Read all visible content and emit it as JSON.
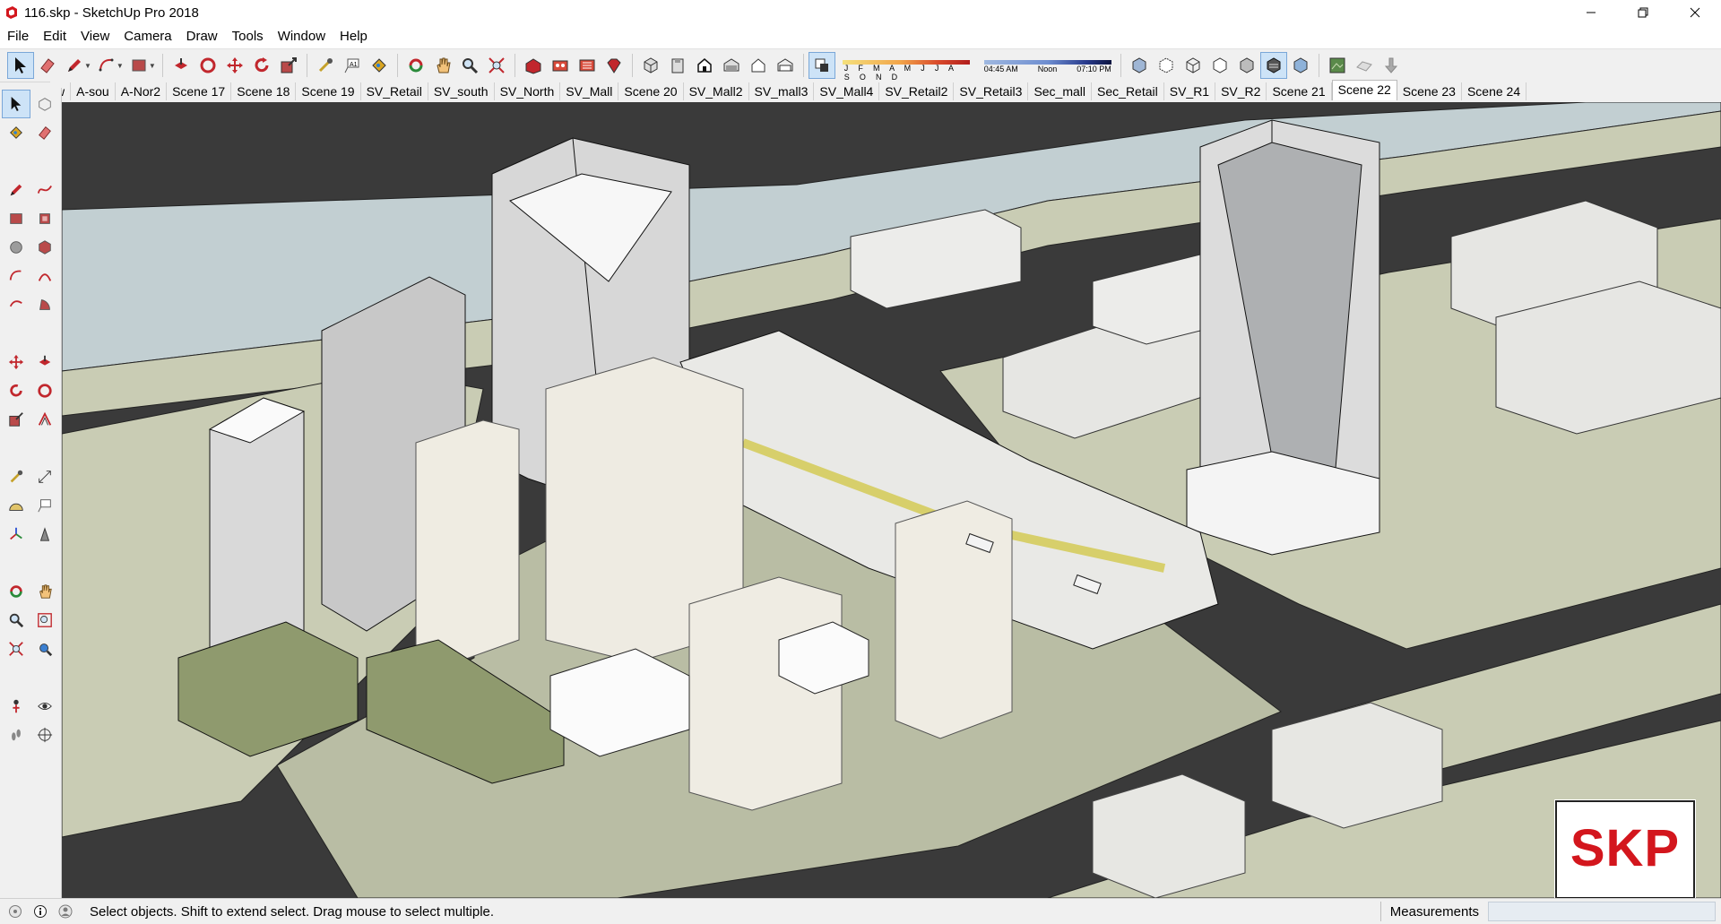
{
  "window": {
    "title": "116.skp - SketchUp Pro 2018",
    "controls": [
      "minimize-icon",
      "restore-icon",
      "close-icon"
    ]
  },
  "menu": {
    "items": [
      "File",
      "Edit",
      "View",
      "Camera",
      "Draw",
      "Tools",
      "Window",
      "Help"
    ]
  },
  "toolbar": {
    "shadow": {
      "months": "J F M A M J J A S O N D",
      "time_start": "04:45 AM",
      "time_noon": "Noon",
      "time_end": "07:10 PM"
    }
  },
  "scenes": {
    "tabs": [
      "w",
      "A-sou",
      "A-Nor2",
      "Scene 17",
      "Scene 18",
      "Scene 19",
      "SV_Retail",
      "SV_south",
      "SV_North",
      "SV_Mall",
      "Scene 20",
      "SV_Mall2",
      "SV_mall3",
      "SV_Mall4",
      "SV_Retail2",
      "SV_Retail3",
      "Sec_mall",
      "Sec_Retail",
      "SV_R1",
      "SV_R2",
      "Scene 21",
      "Scene 22",
      "Scene 23",
      "Scene 24"
    ],
    "active": "Scene 22"
  },
  "status": {
    "message": "Select objects. Shift to extend select. Drag mouse to select multiple.",
    "measurements_label": "Measurements",
    "measurements_value": ""
  },
  "watermark": {
    "text": "SKP"
  },
  "colors": {
    "road": "#3a3a3a",
    "ground": "#c9ccb4",
    "water": "#c2cfd2",
    "building": "#ecebe6",
    "accent_red": "#d3161d"
  }
}
